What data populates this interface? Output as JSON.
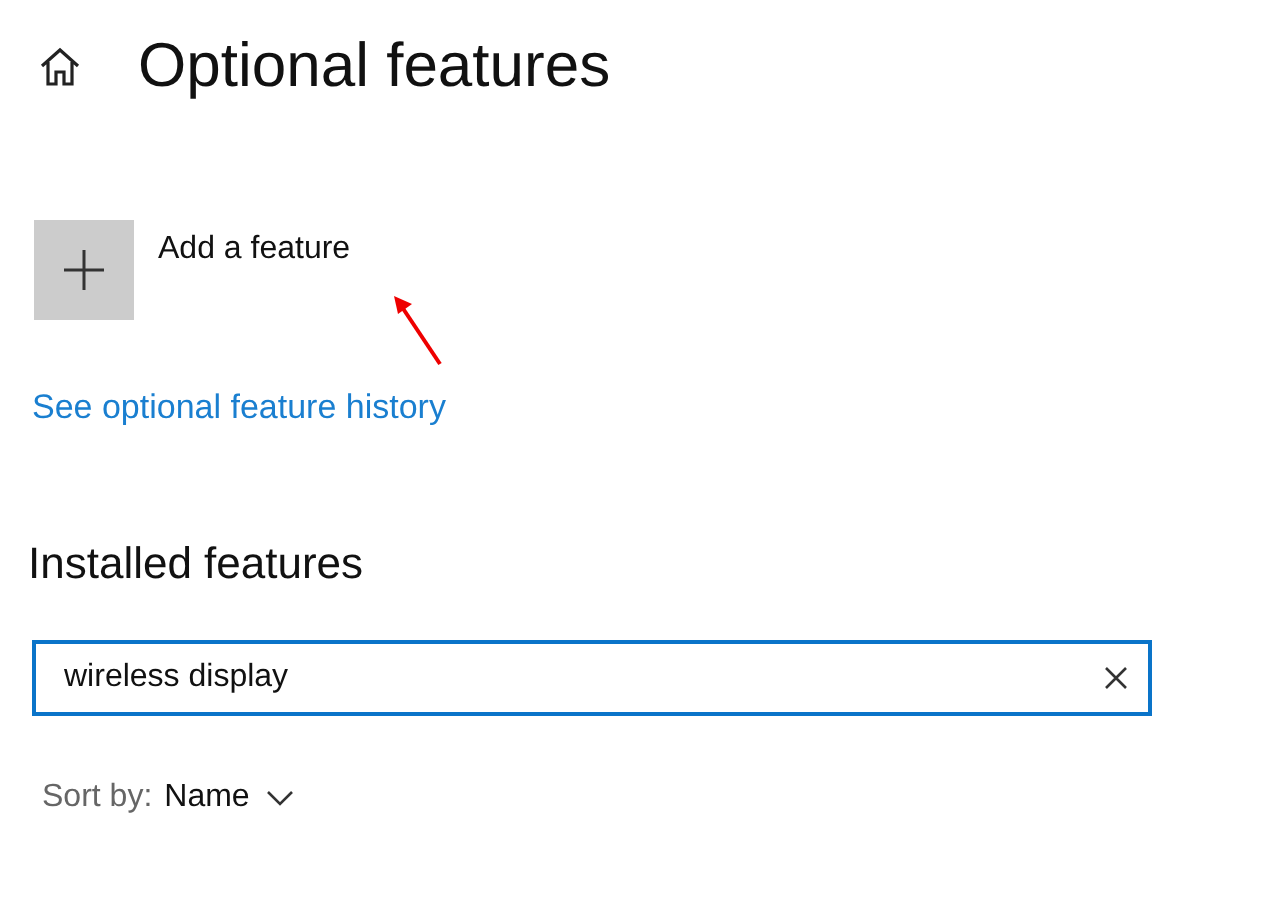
{
  "page": {
    "title": "Optional features"
  },
  "add_feature": {
    "label": "Add a feature"
  },
  "history_link": {
    "label": "See optional feature history"
  },
  "installed": {
    "heading": "Installed features",
    "search": {
      "value": "wireless display"
    },
    "sort": {
      "label": "Sort by:",
      "value": "Name"
    }
  }
}
